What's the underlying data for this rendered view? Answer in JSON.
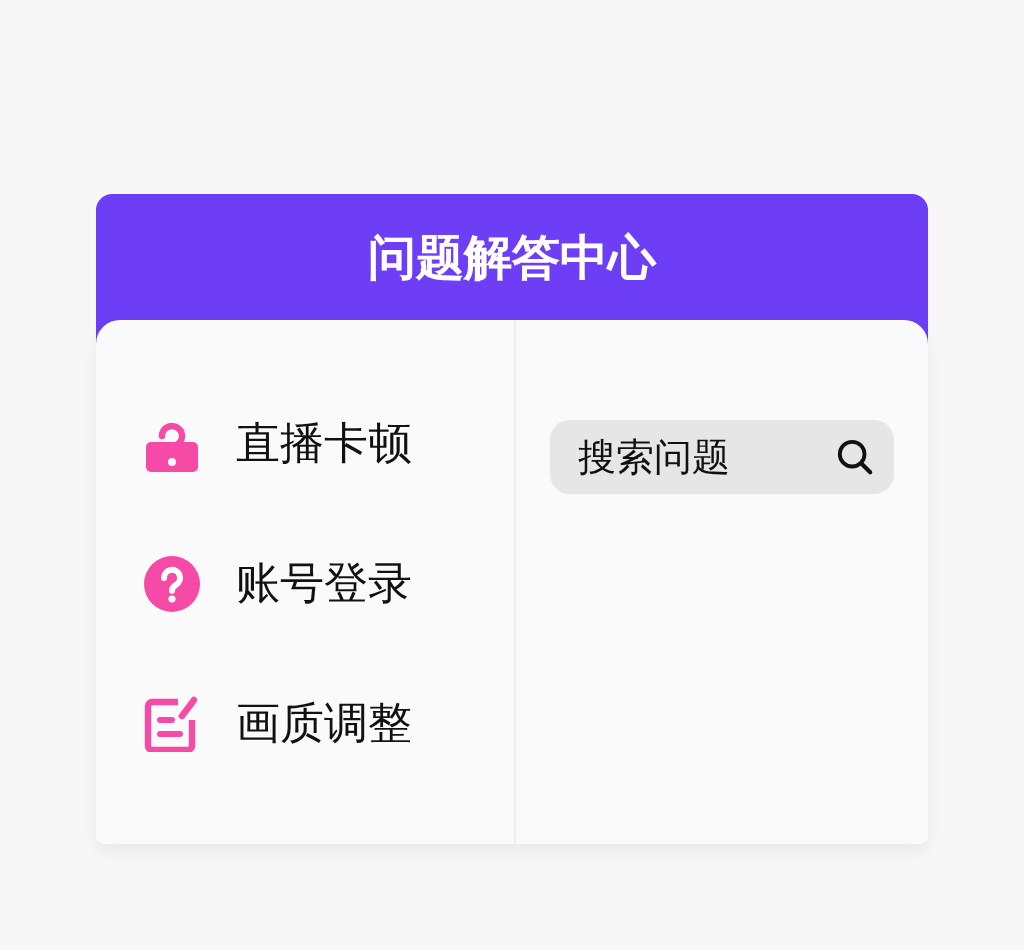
{
  "header": {
    "title": "问题解答中心"
  },
  "menu": [
    {
      "kind": "lock",
      "label": "直播卡顿"
    },
    {
      "kind": "question",
      "label": "账号登录"
    },
    {
      "kind": "edit",
      "label": "画质调整"
    }
  ],
  "search": {
    "placeholder": "搜索问题"
  }
}
